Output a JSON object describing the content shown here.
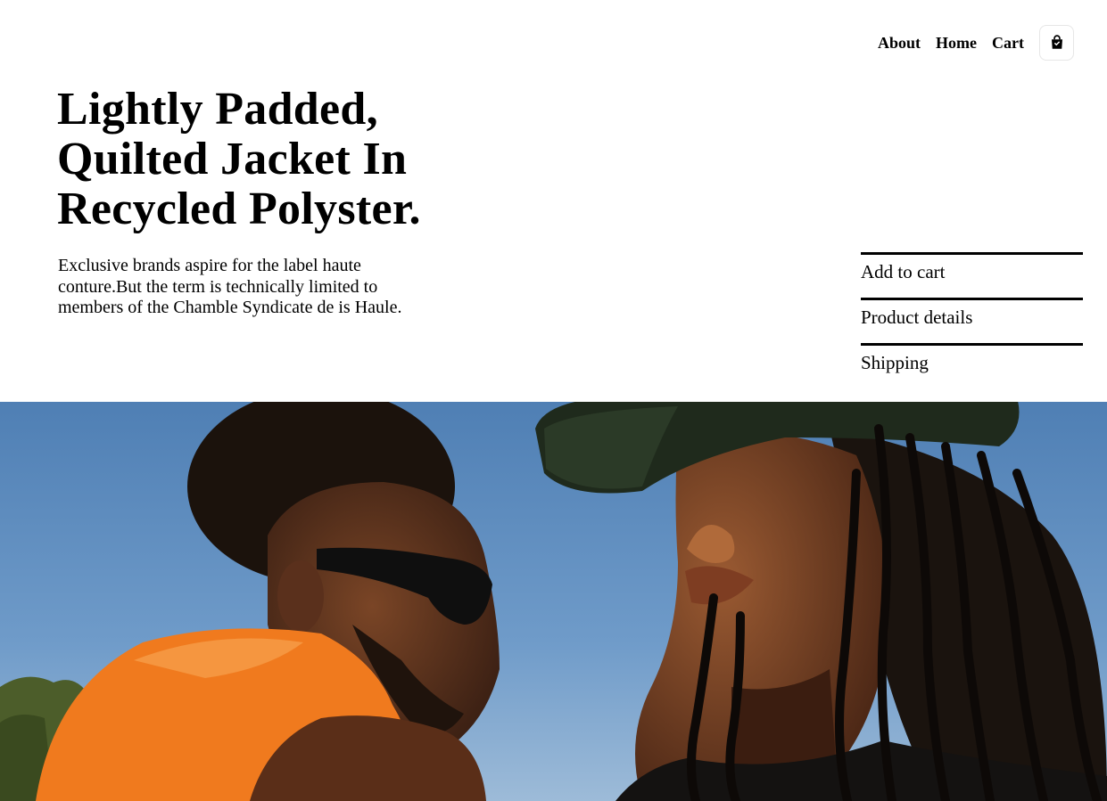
{
  "nav": {
    "links": [
      "About",
      "Home",
      "Cart"
    ],
    "bag_icon": "shopping-bag-icon"
  },
  "hero": {
    "title_lines": [
      "Lightly Padded,",
      "Quilted Jacket In",
      "Recycled Polyster."
    ],
    "description_lines": [
      "Exclusive brands aspire for the label haute",
      "conture.But the term is technically limited to",
      "members of the Chamble Syndicate de is Haule."
    ]
  },
  "actions": [
    "Add to cart",
    "Product details",
    "Shipping"
  ],
  "colors": {
    "background": "#ffffff",
    "text": "#000000",
    "sky": "#5b86b7",
    "orange_hoodie": "#f07a1e",
    "skin": "#5a3320",
    "cap": "#1f2a1c"
  }
}
